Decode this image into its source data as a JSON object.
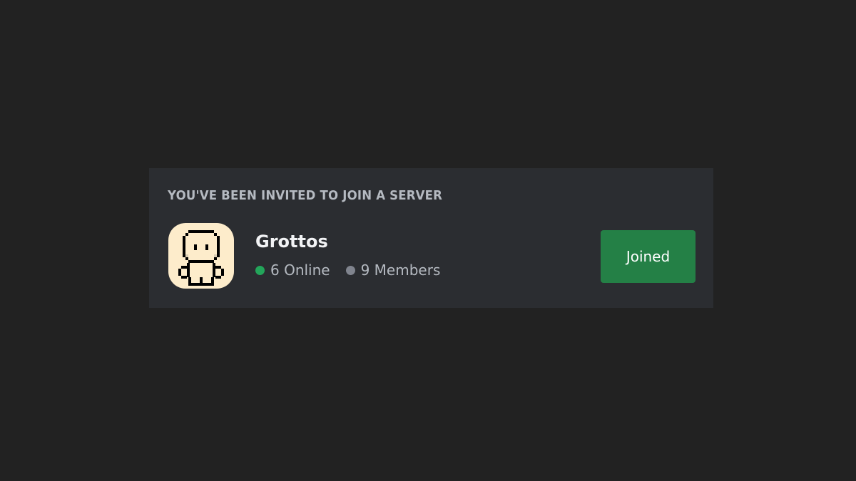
{
  "invite": {
    "header": "YOU'VE BEEN INVITED TO JOIN A SERVER",
    "server_name": "Grottos",
    "icon": "pixel-character-icon",
    "online_text": "6 Online",
    "members_text": "9 Members",
    "button_label": "Joined"
  },
  "colors": {
    "online_dot": "#23a55a",
    "members_dot": "#80848e",
    "button": "#248046",
    "icon_background": "#fdeccb"
  }
}
